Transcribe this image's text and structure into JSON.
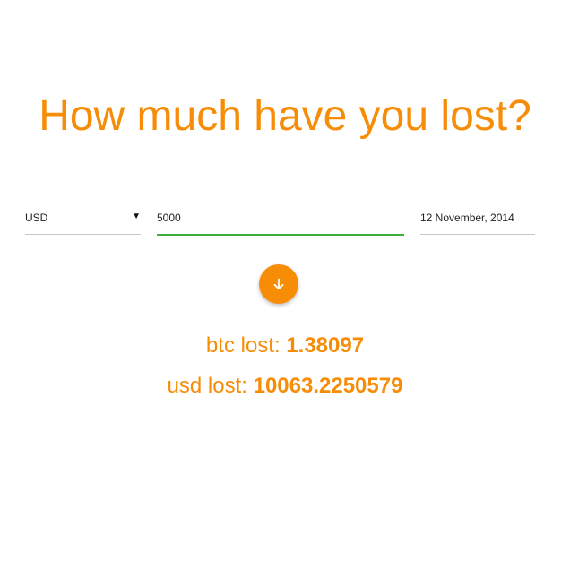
{
  "headline": "How much have you lost?",
  "form": {
    "currency": {
      "selected": "USD",
      "icon": "caret-down-icon"
    },
    "amount": {
      "value": "5000"
    },
    "date": {
      "value": "12 November, 2014"
    }
  },
  "submit": {
    "icon": "arrow-down-icon"
  },
  "results": {
    "btc_label": "btc lost:",
    "btc_value": "1.38097",
    "usd_label": "usd lost:",
    "usd_value": "10063.2250579"
  },
  "colors": {
    "accent": "#f78c07",
    "focus_underline": "#3cae3c",
    "underline": "#c8c8c8"
  }
}
